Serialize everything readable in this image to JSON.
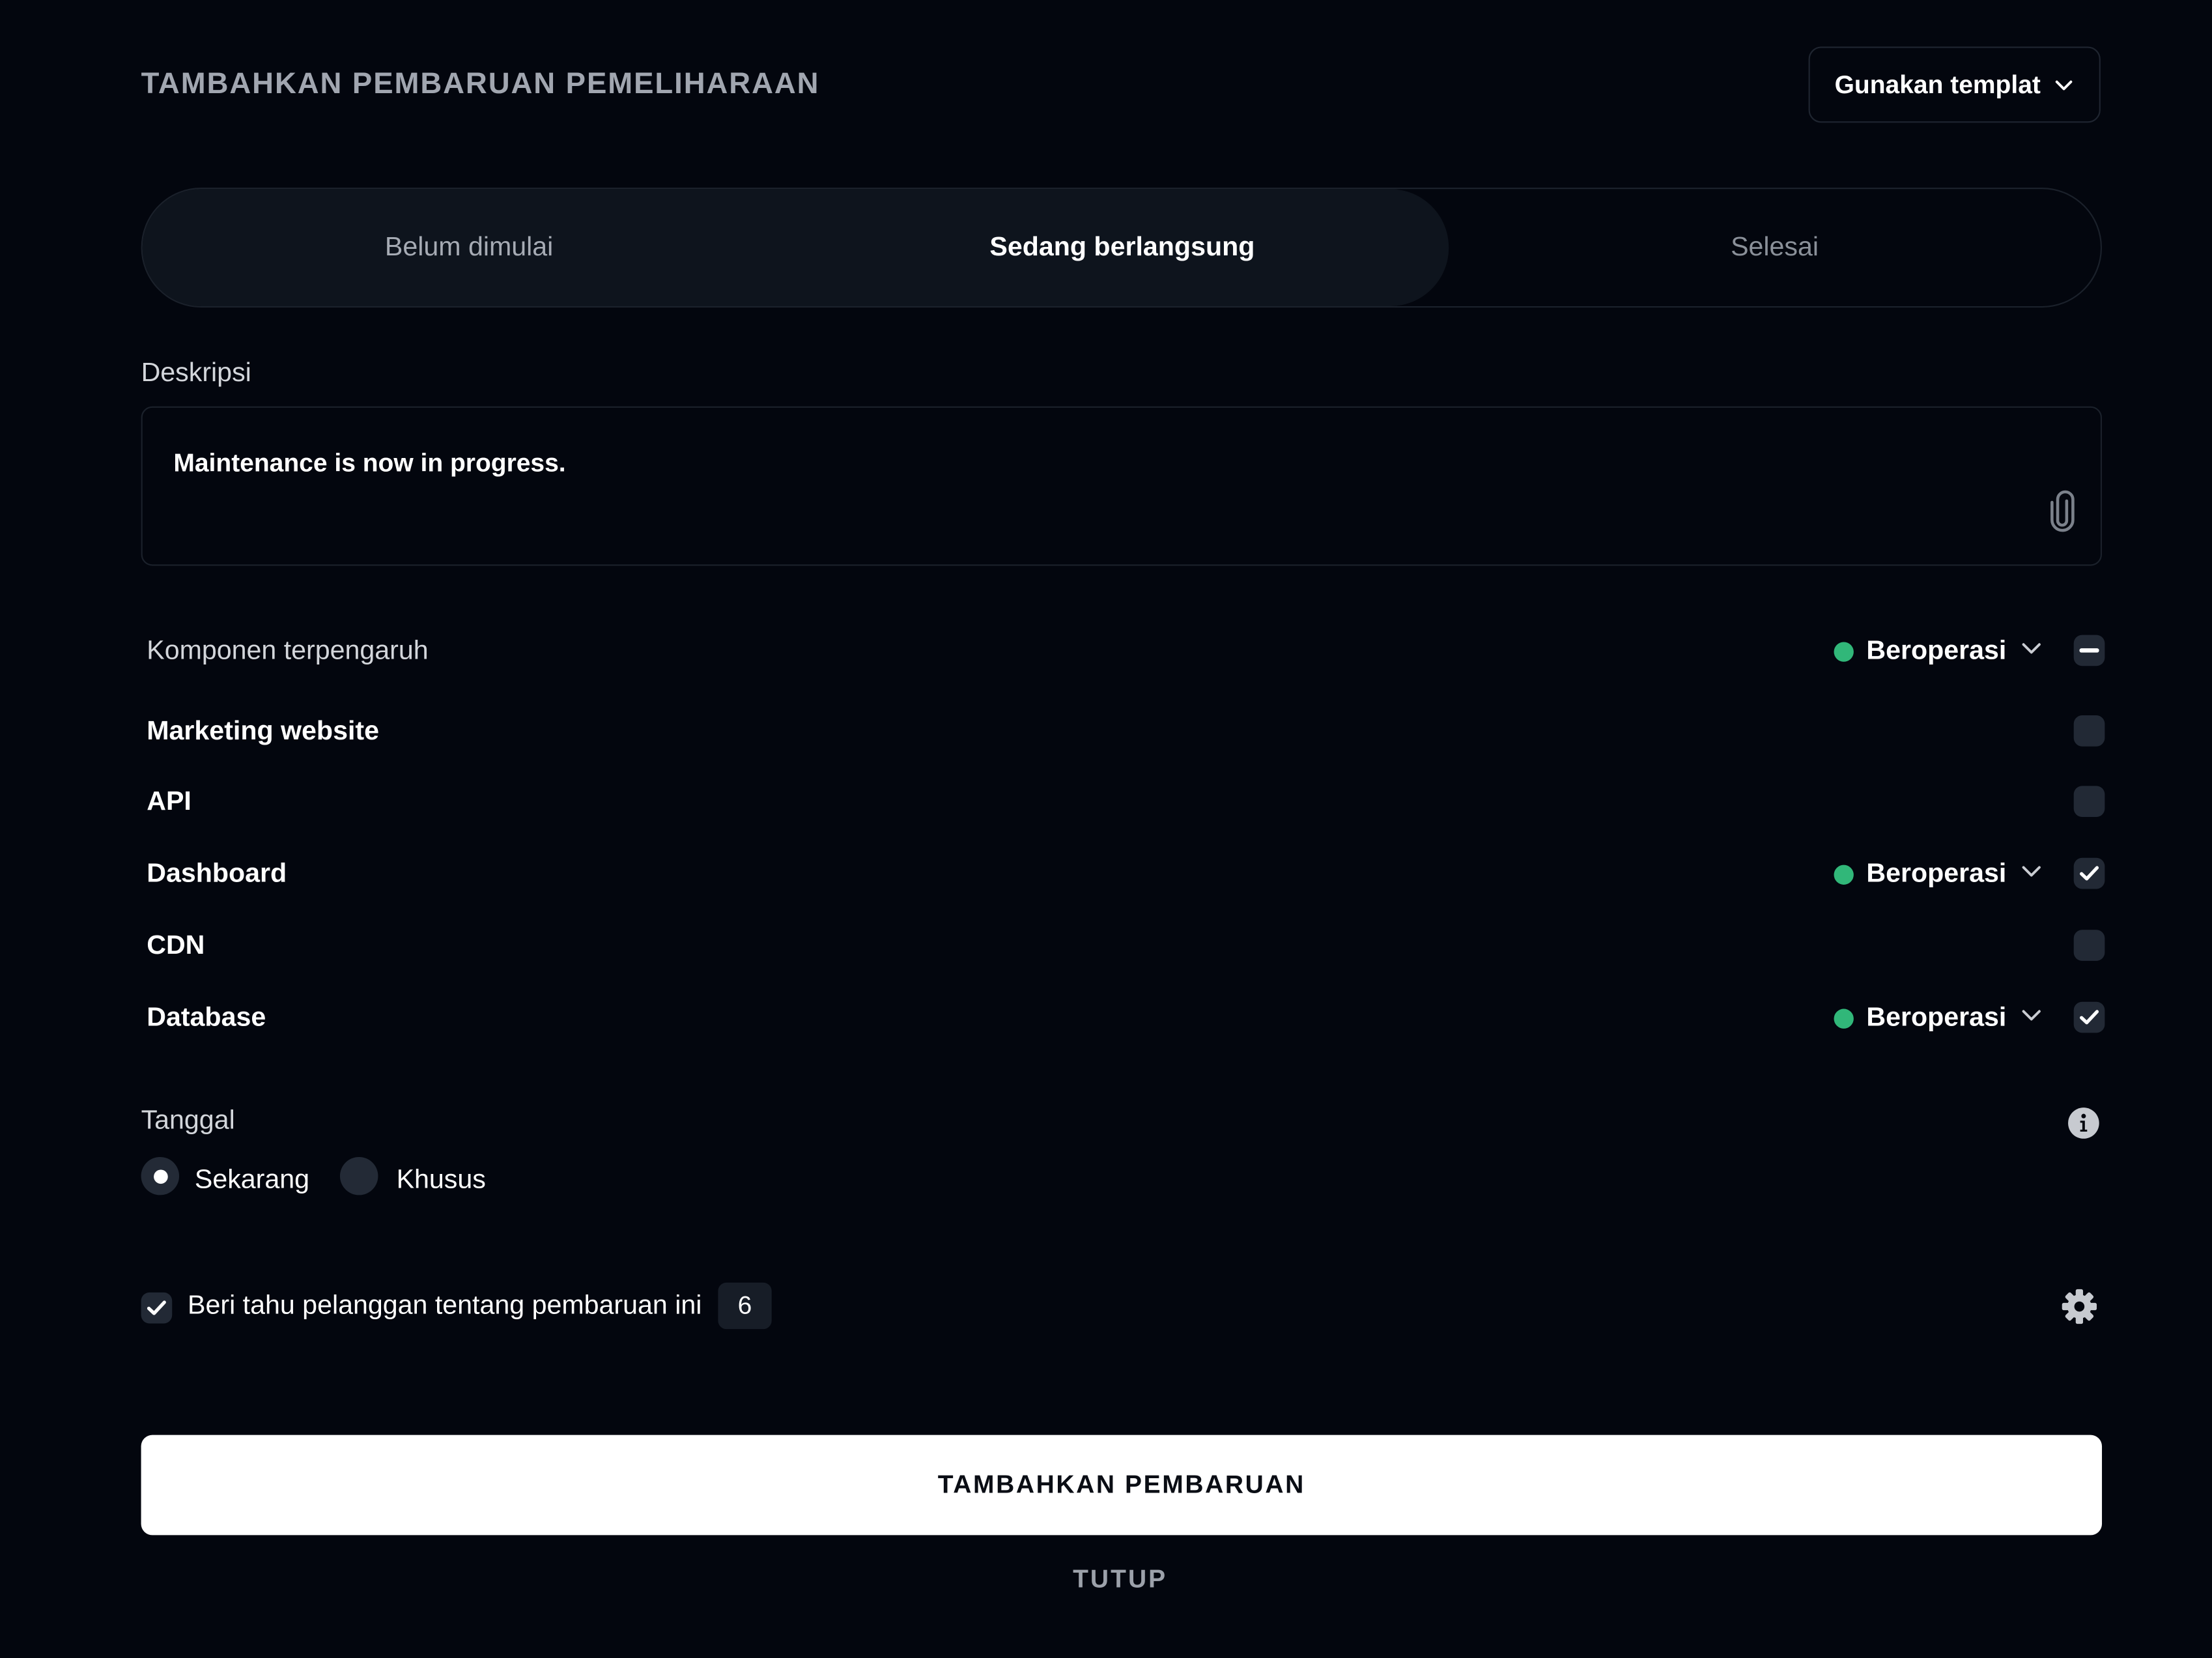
{
  "header": {
    "title": "TAMBAHKAN PEMBARUAN PEMELIHARAAN",
    "template_button": "Gunakan templat"
  },
  "status_tabs": {
    "selected": "Sedang berlangsung",
    "items": [
      "Belum dimulai",
      "Sedang berlangsung",
      "Selesai"
    ]
  },
  "description": {
    "label": "Deskripsi",
    "value": "Maintenance is now in progress."
  },
  "components": {
    "label": "Komponen terpengaruh",
    "bulk_status": "Beroperasi",
    "bulk_state": "indeterminate",
    "status_color": "#31b779",
    "items": [
      {
        "name": "Marketing website",
        "checked": false,
        "status": ""
      },
      {
        "name": "API",
        "checked": false,
        "status": ""
      },
      {
        "name": "Dashboard",
        "checked": true,
        "status": "Beroperasi"
      },
      {
        "name": "CDN",
        "checked": false,
        "status": ""
      },
      {
        "name": "Database",
        "checked": true,
        "status": "Beroperasi"
      }
    ]
  },
  "date": {
    "label": "Tanggal",
    "selected": "Sekarang",
    "options": [
      "Sekarang",
      "Khusus"
    ]
  },
  "notify": {
    "checked": true,
    "label": "Beri tahu pelanggan tentang pembaruan ini",
    "count": "6"
  },
  "actions": {
    "primary": "TAMBAHKAN PEMBARUAN",
    "secondary": "TUTUP"
  },
  "icons": {
    "template_chevron": "chevron-down-icon",
    "attachment": "paperclip-icon",
    "status_chevron": "chevron-down-icon",
    "info": "info-icon",
    "settings": "gear-icon"
  }
}
